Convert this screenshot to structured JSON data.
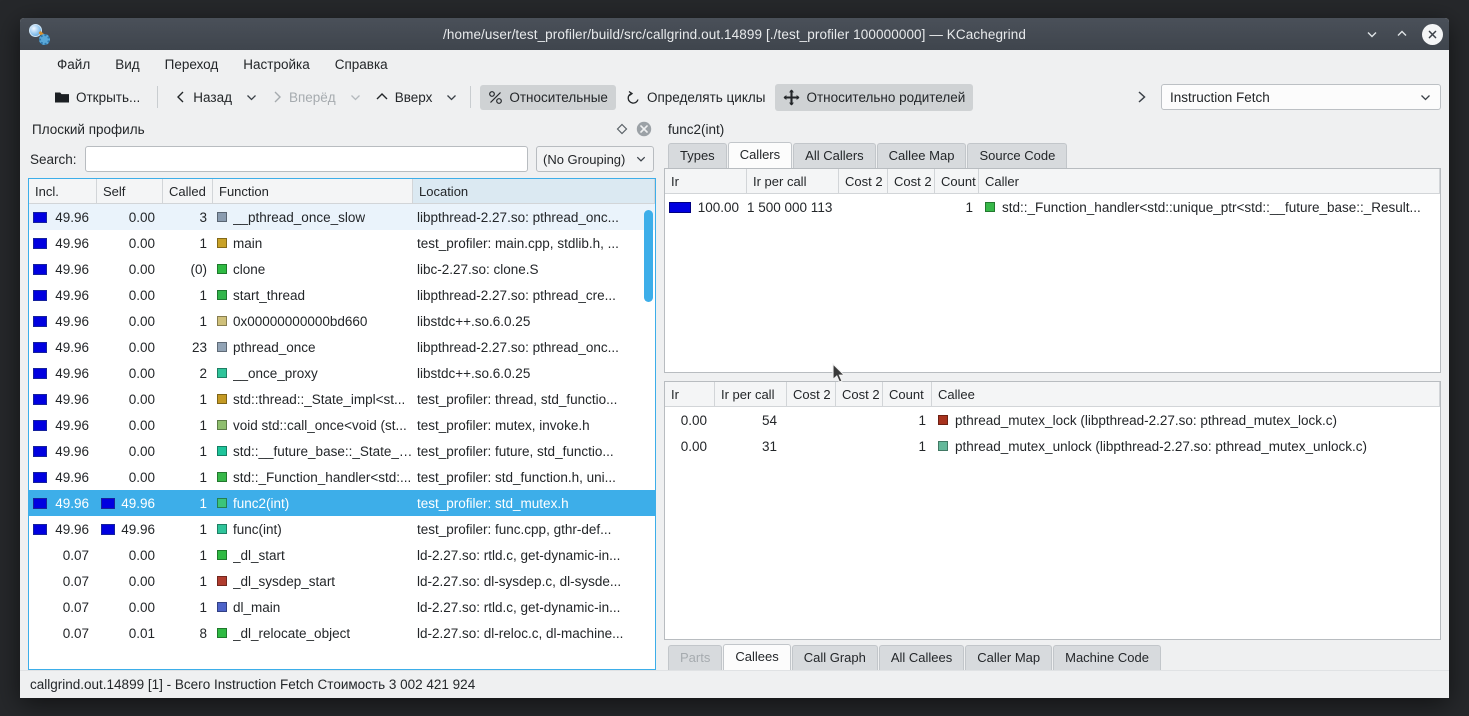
{
  "window": {
    "title": "/home/user/test_profiler/build/src/callgrind.out.14899 [./test_profiler 100000000] — KCachegrind",
    "app_icon": "kcachegrind-icon",
    "minimize_label": "",
    "maximize_label": "",
    "close_label": ""
  },
  "menubar": {
    "items": [
      {
        "label": "Файл"
      },
      {
        "label": "Вид"
      },
      {
        "label": "Переход"
      },
      {
        "label": "Настройка"
      },
      {
        "label": "Справка"
      }
    ]
  },
  "toolbar": {
    "open_label": "Открыть...",
    "back_label": "Назад",
    "forward_label": "Вперёд",
    "up_label": "Вверх",
    "relative_label": "Относительные",
    "cycles_label": "Определять циклы",
    "relative_to_parent_label": "Относительно родителей",
    "event_combo_value": "Instruction Fetch"
  },
  "flat_profile": {
    "dock_title": "Плоский профиль",
    "search_label": "Search:",
    "search_value": "",
    "search_placeholder": "",
    "grouping_value": "(No Grouping)",
    "columns": [
      "Incl.",
      "Self",
      "Called",
      "Function",
      "Location"
    ],
    "rows": [
      {
        "incl": "49.96",
        "self": "0.00",
        "called": "3",
        "function": "__pthread_once_slow",
        "swatch": "#8a9cb0",
        "location": "libpthread-2.27.so: pthread_onc...",
        "incl_bar": true,
        "self_bar": false,
        "state": "alt"
      },
      {
        "incl": "49.96",
        "self": "0.00",
        "called": "1",
        "function": "main",
        "swatch": "#c9a227",
        "location": "test_profiler: main.cpp, stdlib.h, ...",
        "incl_bar": true,
        "self_bar": false,
        "state": ""
      },
      {
        "incl": "49.96",
        "self": "0.00",
        "called": "(0)",
        "function": "clone",
        "swatch": "#2fba43",
        "location": "libc-2.27.so: clone.S",
        "incl_bar": true,
        "self_bar": false,
        "state": ""
      },
      {
        "incl": "49.96",
        "self": "0.00",
        "called": "1",
        "function": "start_thread",
        "swatch": "#31b54a",
        "location": "libpthread-2.27.so: pthread_cre...",
        "incl_bar": true,
        "self_bar": false,
        "state": ""
      },
      {
        "incl": "49.96",
        "self": "0.00",
        "called": "1",
        "function": "0x00000000000bd660",
        "swatch": "#cfc07a",
        "location": "libstdc++.so.6.0.25",
        "incl_bar": true,
        "self_bar": false,
        "state": ""
      },
      {
        "incl": "49.96",
        "self": "0.00",
        "called": "23",
        "function": "pthread_once",
        "swatch": "#92a4b6",
        "location": "libpthread-2.27.so: pthread_onc...",
        "incl_bar": true,
        "self_bar": false,
        "state": ""
      },
      {
        "incl": "49.96",
        "self": "0.00",
        "called": "2",
        "function": "__once_proxy",
        "swatch": "#2fc49a",
        "location": "libstdc++.so.6.0.25",
        "incl_bar": true,
        "self_bar": false,
        "state": ""
      },
      {
        "incl": "49.96",
        "self": "0.00",
        "called": "1",
        "function": "std::thread::_State_impl<st...",
        "swatch": "#c49a24",
        "location": "test_profiler: thread, std_functio...",
        "incl_bar": true,
        "self_bar": false,
        "state": ""
      },
      {
        "incl": "49.96",
        "self": "0.00",
        "called": "1",
        "function": "void std::call_once<void (st...",
        "swatch": "#8fbf6e",
        "location": "test_profiler: mutex, invoke.h",
        "incl_bar": true,
        "self_bar": false,
        "state": ""
      },
      {
        "incl": "49.96",
        "self": "0.00",
        "called": "1",
        "function": "std::__future_base::_State_b...",
        "swatch": "#1ec49a",
        "location": "test_profiler: future, std_functio...",
        "incl_bar": true,
        "self_bar": false,
        "state": ""
      },
      {
        "incl": "49.96",
        "self": "0.00",
        "called": "1",
        "function": "std::_Function_handler<std:...",
        "swatch": "#37b849",
        "location": "test_profiler: std_function.h, uni...",
        "incl_bar": true,
        "self_bar": false,
        "state": ""
      },
      {
        "incl": "49.96",
        "self": "49.96",
        "called": "1",
        "function": "func2(int)",
        "swatch": "#3bc47a",
        "location": "test_profiler: std_mutex.h",
        "incl_bar": true,
        "self_bar": true,
        "state": "sel"
      },
      {
        "incl": "49.96",
        "self": "49.96",
        "called": "1",
        "function": "func(int)",
        "swatch": "#2fc49a",
        "location": "test_profiler: func.cpp, gthr-def...",
        "incl_bar": true,
        "self_bar": true,
        "state": ""
      },
      {
        "incl": "0.07",
        "self": "0.00",
        "called": "1",
        "function": "_dl_start",
        "swatch": "#2fba43",
        "location": "ld-2.27.so: rtld.c, get-dynamic-in...",
        "incl_bar": false,
        "self_bar": false,
        "state": ""
      },
      {
        "incl": "0.07",
        "self": "0.00",
        "called": "1",
        "function": "_dl_sysdep_start",
        "swatch": "#b03c2e",
        "location": "ld-2.27.so: dl-sysdep.c, dl-sysde...",
        "incl_bar": false,
        "self_bar": false,
        "state": ""
      },
      {
        "incl": "0.07",
        "self": "0.00",
        "called": "1",
        "function": "dl_main",
        "swatch": "#4d63c9",
        "location": "ld-2.27.so: rtld.c, get-dynamic-in...",
        "incl_bar": false,
        "self_bar": false,
        "state": ""
      },
      {
        "incl": "0.07",
        "self": "0.01",
        "called": "8",
        "function": "_dl_relocate_object",
        "swatch": "#2fba43",
        "location": "ld-2.27.so: dl-reloc.c, dl-machine...",
        "incl_bar": false,
        "self_bar": false,
        "state": ""
      }
    ]
  },
  "detail": {
    "function_title": "func2(int)",
    "top_tabs": [
      {
        "label": "Types",
        "active": false,
        "disabled": false
      },
      {
        "label": "Callers",
        "active": true,
        "disabled": false
      },
      {
        "label": "All Callers",
        "active": false,
        "disabled": false
      },
      {
        "label": "Callee Map",
        "active": false,
        "disabled": false
      },
      {
        "label": "Source Code",
        "active": false,
        "disabled": false
      }
    ],
    "callers": {
      "columns": [
        "Ir",
        "Ir per call",
        "Cost 2",
        "Cost 2",
        "Count",
        "Caller"
      ],
      "rows": [
        {
          "ir": "100.00",
          "ir_per_call": "1 500 000 113",
          "cost2a": "",
          "cost2b": "",
          "count": "1",
          "swatch": "#37b849",
          "caller": "std::_Function_handler<std::unique_ptr<std::__future_base::_Result...",
          "has_bar": true
        }
      ]
    },
    "callees": {
      "columns": [
        "Ir",
        "Ir per call",
        "Cost 2",
        "Cost 2",
        "Count",
        "Callee"
      ],
      "rows": [
        {
          "ir": "0.00",
          "ir_per_call": "54",
          "cost2a": "",
          "cost2b": "",
          "count": "1",
          "swatch": "#a8321e",
          "callee": "pthread_mutex_lock (libpthread-2.27.so: pthread_mutex_lock.c)",
          "has_bar": false
        },
        {
          "ir": "0.00",
          "ir_per_call": "31",
          "cost2a": "",
          "cost2b": "",
          "count": "1",
          "swatch": "#64b89a",
          "callee": "pthread_mutex_unlock (libpthread-2.27.so: pthread_mutex_unlock.c)",
          "has_bar": false
        }
      ]
    },
    "bottom_tabs": [
      {
        "label": "Parts",
        "active": false,
        "disabled": true
      },
      {
        "label": "Callees",
        "active": true,
        "disabled": false
      },
      {
        "label": "Call Graph",
        "active": false,
        "disabled": false
      },
      {
        "label": "All Callees",
        "active": false,
        "disabled": false
      },
      {
        "label": "Caller Map",
        "active": false,
        "disabled": false
      },
      {
        "label": "Machine Code",
        "active": false,
        "disabled": false
      }
    ]
  },
  "statusbar": {
    "text": "callgrind.out.14899 [1] - Всего Instruction Fetch Стоимость 3 002 421 924"
  },
  "colors": {
    "selection": "#3daee9",
    "window_bg": "#eff0f1",
    "titlebar": "#434950",
    "bar_blue": "#0000e0"
  }
}
